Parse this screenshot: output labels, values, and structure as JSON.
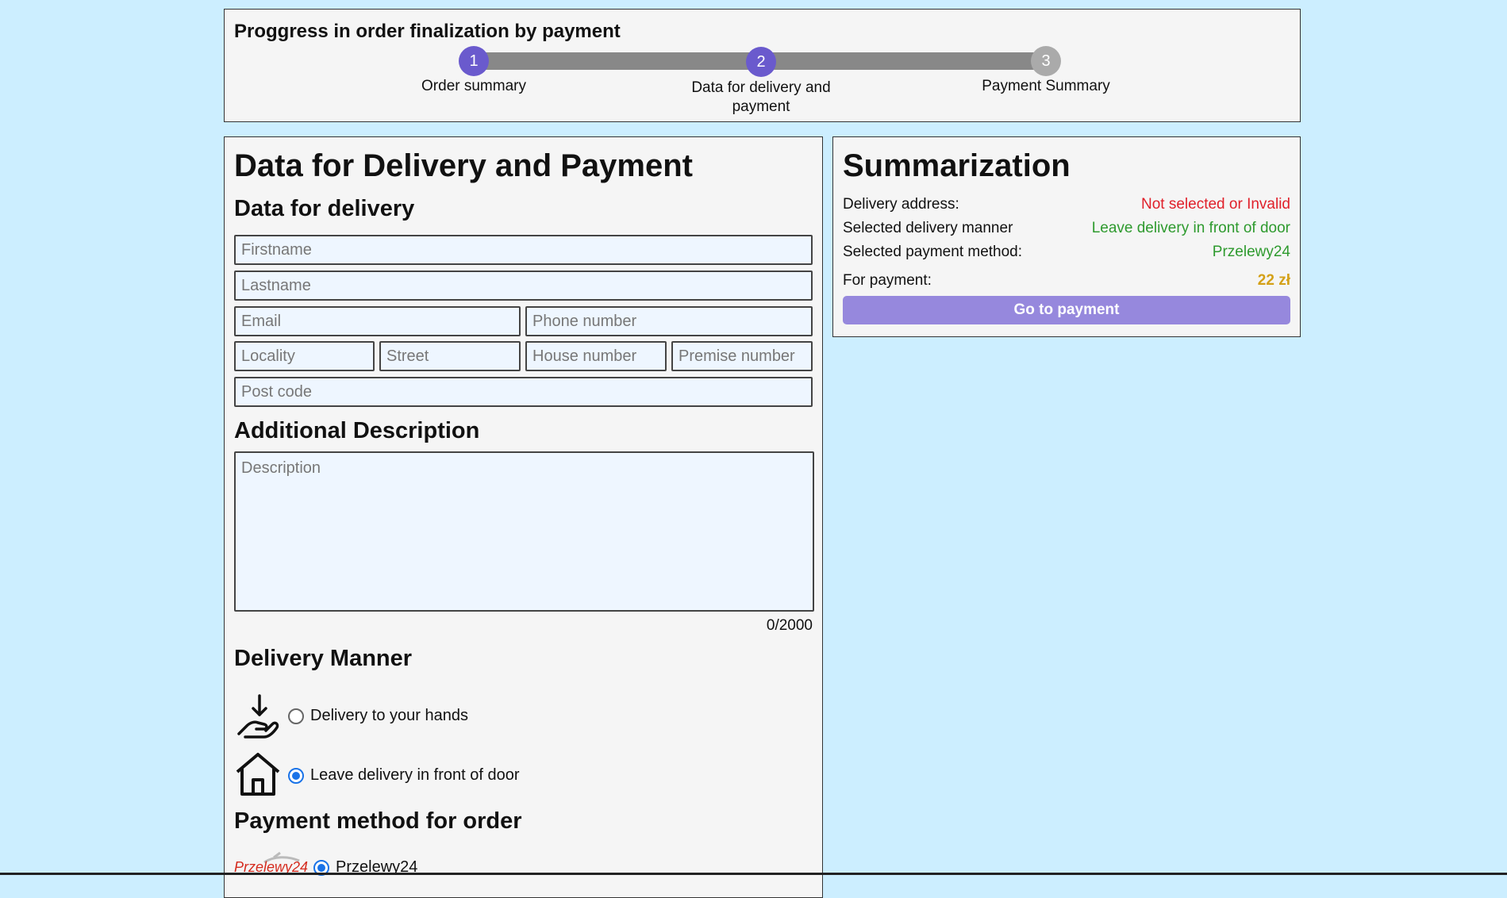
{
  "progress": {
    "title": "Proggress in order finalization by payment",
    "steps": [
      {
        "number": "1",
        "label": "Order summary",
        "state": "active"
      },
      {
        "number": "2",
        "label": "Data for delivery and payment",
        "state": "active"
      },
      {
        "number": "3",
        "label": "Payment Summary",
        "state": "inactive"
      }
    ]
  },
  "form": {
    "title": "Data for Delivery and Payment",
    "delivery_heading": "Data for delivery",
    "placeholders": {
      "firstname": "Firstname",
      "lastname": "Lastname",
      "email": "Email",
      "phone": "Phone number",
      "locality": "Locality",
      "street": "Street",
      "house_number": "House number",
      "premise_number": "Premise number",
      "post_code": "Post code",
      "description": "Description"
    },
    "description_heading": "Additional Description",
    "description_counter": "0/2000",
    "delivery_manner_heading": "Delivery Manner",
    "delivery_options": [
      {
        "label": "Delivery to your hands",
        "icon": "hand-delivery-icon",
        "checked": false
      },
      {
        "label": "Leave delivery in front of door",
        "icon": "house-icon",
        "checked": true
      }
    ],
    "payment_heading": "Payment method for order",
    "payment_options": [
      {
        "label": "Przelewy24",
        "logo_text": "Przelewy24",
        "checked": true
      }
    ]
  },
  "summary": {
    "title": "Summarization",
    "rows": [
      {
        "label": "Delivery address:",
        "value": "Not selected or Invalid"
      },
      {
        "label": "Selected delivery manner",
        "value": "Leave delivery in front of door"
      },
      {
        "label": "Selected payment method:",
        "value": "Przelewy24"
      },
      {
        "label": "For payment:",
        "value": "22 zł"
      }
    ],
    "button_label": "Go to payment"
  },
  "colors": {
    "background": "#cceeff",
    "accent": "#6a5acd",
    "button": "#9688dd",
    "invalid": "#e0202a",
    "valid": "#2e9a2e",
    "price": "#d4a017"
  }
}
